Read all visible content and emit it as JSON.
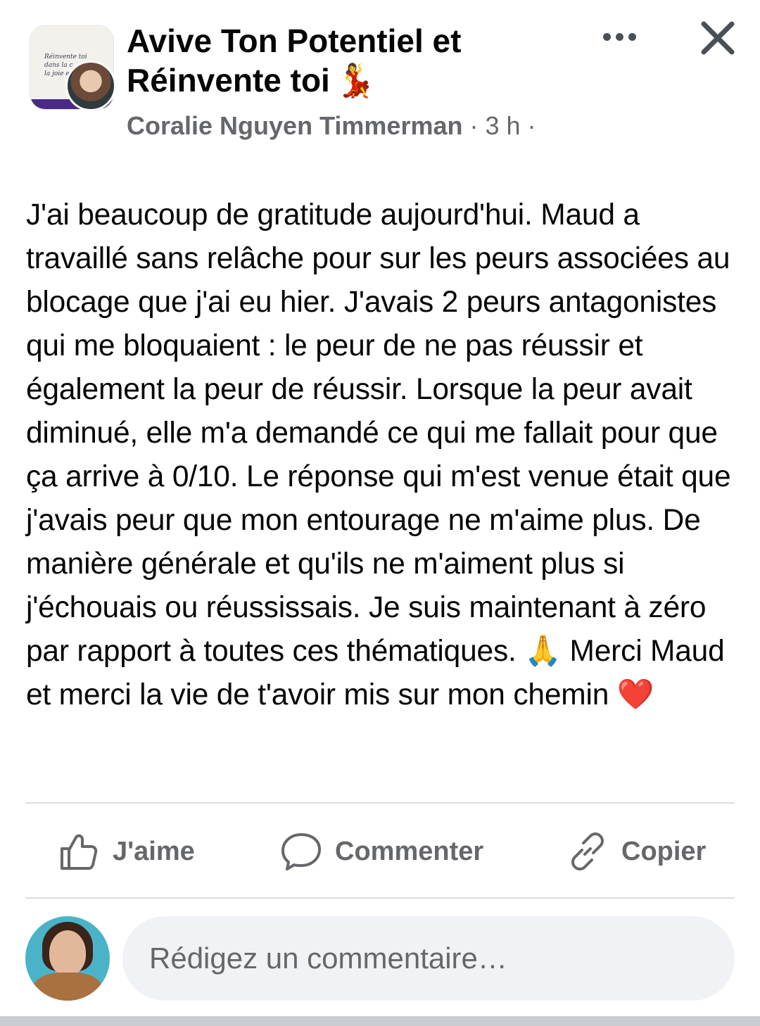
{
  "header": {
    "group_name": "Avive Ton Potentiel et Réinvente toi",
    "group_name_emoji": "💃",
    "group_avatar_text": [
      "Réinvente toi",
      "dans la c",
      "la joie e"
    ],
    "author": "Coralie Nguyen Timmerman",
    "separator": " · ",
    "time": "3 h",
    "privacy_separator": " ·",
    "more_icon": "more-horizontal-icon",
    "close_icon": "close-icon"
  },
  "post": {
    "text_part1": "J'ai beaucoup de gratitude aujourd'hui. Maud a travaillé sans relâche pour sur les peurs associées au blocage que j'ai eu hier. J'avais 2 peurs antagonistes qui me bloquaient : le peur de ne pas réussir et également la peur de réussir. Lorsque la peur avait diminué, elle m'a demandé ce qui me fallait pour que ça arrive à 0/10. Le réponse qui m'est venue était que j'avais peur que mon entourage ne m'aime plus. De manière générale et qu'ils ne m'aiment plus si j'échouais ou réussissais. Je suis maintenant à zéro par rapport à toutes ces thématiques. ",
    "emoji_pray": "🙏",
    "text_part2": " Merci Maud et merci la vie de t'avoir mis sur mon chemin ",
    "emoji_heart": "❤️"
  },
  "actions": {
    "like_label": "J'aime",
    "comment_label": "Commenter",
    "copy_label": "Copier",
    "like_icon": "thumbs-up-icon",
    "comment_icon": "comment-bubble-icon",
    "copy_icon": "link-icon"
  },
  "composer": {
    "placeholder": "Rédigez un commentaire…",
    "value": ""
  },
  "colors": {
    "text_primary": "#050505",
    "text_secondary": "#65676b",
    "divider": "#dadde1",
    "input_bg": "#f0f2f5",
    "group_avatar_band": "#4b2a86"
  }
}
